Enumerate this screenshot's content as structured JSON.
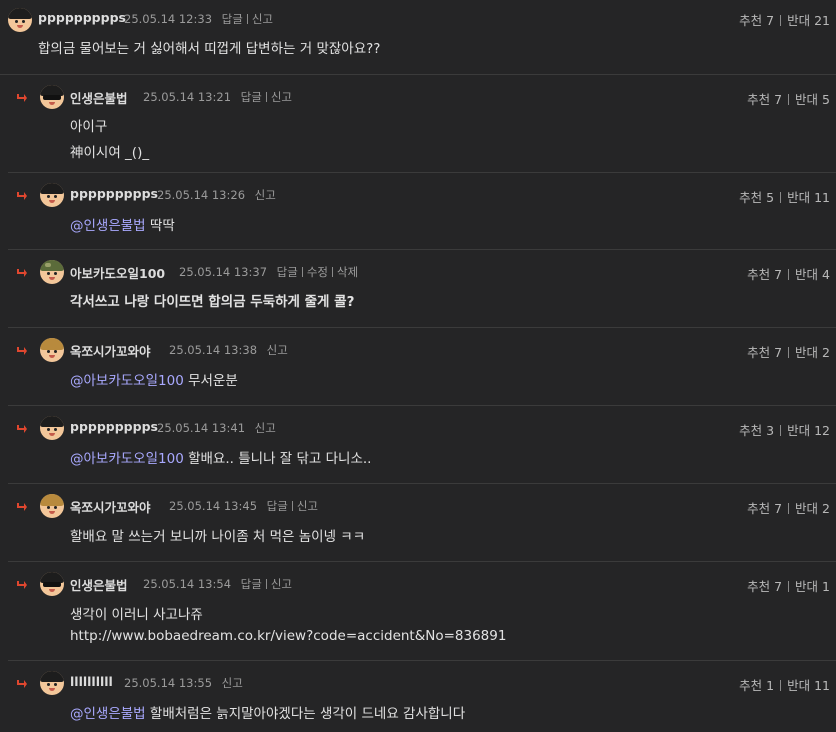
{
  "comments": [
    {
      "nick": "ppppppppps",
      "date": "25.05.14 12:33",
      "actions": [
        "답글",
        "신고"
      ],
      "up_label": "추천",
      "up": "7",
      "down_label": "반대",
      "down": "21",
      "lines": [
        "합의금 물어보는 거 싫어해서 띠껍게 답변하는 거 맞잖아요??"
      ]
    },
    {
      "nick": "인생은불법",
      "date": "25.05.14 13:21",
      "actions": [
        "답글",
        "신고"
      ],
      "up_label": "추천",
      "up": "7",
      "down_label": "반대",
      "down": "5",
      "lines": [
        "아이구",
        "神이시여 _()_"
      ]
    },
    {
      "nick": "ppppppppps",
      "date": "25.05.14 13:26",
      "actions": [
        "신고"
      ],
      "up_label": "추천",
      "up": "5",
      "down_label": "반대",
      "down": "11",
      "mention": "@인생은불법",
      "lines": [
        "딱딱"
      ]
    },
    {
      "nick": "아보카도오일100",
      "date": "25.05.14 13:37",
      "actions": [
        "답글",
        "수정",
        "삭제"
      ],
      "up_label": "추천",
      "up": "7",
      "down_label": "반대",
      "down": "4",
      "lines": [
        "각서쓰고 나랑 다이뜨면 합의금 두둑하게 줄게 콜?"
      ]
    },
    {
      "nick": "옥쪼시가꼬와야",
      "date": "25.05.14 13:38",
      "actions": [
        "신고"
      ],
      "up_label": "추천",
      "up": "7",
      "down_label": "반대",
      "down": "2",
      "mention": "@아보카도오일100",
      "lines": [
        "무서운분"
      ]
    },
    {
      "nick": "ppppppppps",
      "date": "25.05.14 13:41",
      "actions": [
        "신고"
      ],
      "up_label": "추천",
      "up": "3",
      "down_label": "반대",
      "down": "12",
      "mention": "@아보카도오일100",
      "lines": [
        "할배요.. 틀니나 잘 닦고 다니소.."
      ]
    },
    {
      "nick": "옥쪼시가꼬와야",
      "date": "25.05.14 13:45",
      "actions": [
        "답글",
        "신고"
      ],
      "up_label": "추천",
      "up": "7",
      "down_label": "반대",
      "down": "2",
      "lines": [
        "할배요 말 쓰는거 보니까 나이좀 처 먹은 놈이넹 ㅋㅋ"
      ]
    },
    {
      "nick": "인생은불법",
      "date": "25.05.14 13:54",
      "actions": [
        "답글",
        "신고"
      ],
      "up_label": "추천",
      "up": "7",
      "down_label": "반대",
      "down": "1",
      "lines": [
        "생각이 이러니 사고나쥬",
        "http://www.bobaedream.co.kr/view?code=accident&No=836891"
      ]
    },
    {
      "nick": "llllllllll",
      "date": "25.05.14 13:55",
      "actions": [
        "신고"
      ],
      "up_label": "추천",
      "up": "1",
      "down_label": "반대",
      "down": "11",
      "mention": "@인생은불법",
      "lines": [
        "할배처럼은 늙지말아야겠다는 생각이 드네요 감사합니다"
      ]
    }
  ],
  "colors": {
    "background": "#252526",
    "mention": "#a9a9ff",
    "reply_arrow": "#e0472f"
  }
}
